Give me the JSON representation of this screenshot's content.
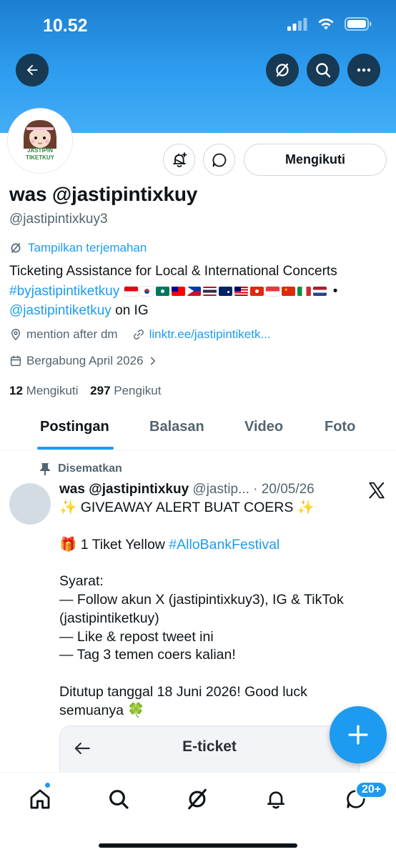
{
  "status_bar": {
    "time": "10.52",
    "icons": [
      "cellular-signal-icon",
      "wifi-icon",
      "battery-icon"
    ]
  },
  "header": {
    "buttons": [
      "back-arrow-icon",
      "translate-icon",
      "search-icon",
      "more-icon"
    ]
  },
  "profile": {
    "avatar_text": [
      "JASTIPIN",
      "TIKETKUY"
    ],
    "follow_label": "Mengikuti",
    "name": "was @jastipintixkuy",
    "handle": "@jastipintixkuy3",
    "translate_label": "Tampilkan terjemahan",
    "bio": {
      "line1": "Ticketing Assistance for Local & International Concerts",
      "hashtag": "#byjastipintiketkuy",
      "flags": [
        "ID",
        "KR",
        "MO",
        "TW",
        "PH",
        "TH",
        "AU",
        "MY",
        "HK",
        "SG",
        "CN",
        "IT",
        "NL"
      ],
      "separator": "•",
      "ig_mention": "@jastipintiketkuy",
      "ig_suffix": "on IG"
    },
    "location": "mention after dm",
    "website": "linktr.ee/jastipintiketk...",
    "joined": "Bergabung April 2026",
    "following_count": "12",
    "following_label": "Mengikuti",
    "followers_count": "297",
    "followers_label": "Pengikut"
  },
  "tabs": [
    {
      "label": "Postingan",
      "active": true
    },
    {
      "label": "Balasan",
      "active": false
    },
    {
      "label": "Video",
      "active": false
    },
    {
      "label": "Foto",
      "active": false
    }
  ],
  "post": {
    "pinned_label": "Disematkan",
    "author_name": "was @jastipintixkuy",
    "author_meta": "@jastip... · 20/05/26",
    "line1": "✨ GIVEAWAY ALERT BUAT COERS ✨",
    "line2_emoji": "🎁",
    "line2_text": "1 Tiket Yellow",
    "line2_hashtag": "#AlloBankFestival",
    "requirements_title": "Syarat:",
    "req1a": "— Follow akun X (jastipintixkuy3), IG & TikTok",
    "req1b": "(jastipintiketkuy)",
    "req2": "— Like & repost tweet ini",
    "req3": "— Tag 3 temen coers kalian!",
    "closing1": "Ditutup tanggal 18 Juni 2026! Good luck",
    "closing2": "semuanya 🍀",
    "media_title": "E-ticket"
  },
  "bottom_nav": {
    "items": [
      "home-icon",
      "search-icon",
      "grok-icon",
      "notifications-icon",
      "messages-icon"
    ],
    "messages_badge": "20+"
  },
  "colors": {
    "accent": "#1d9bf0",
    "banner": "#2e9df0",
    "text_secondary": "#536471"
  }
}
